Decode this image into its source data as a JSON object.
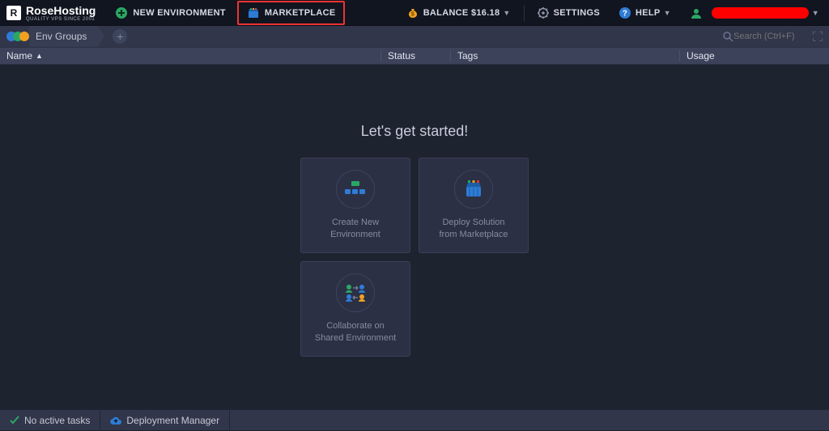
{
  "brand": {
    "name": "RoseHosting",
    "tagline": "QUALITY VPS SINCE 2001"
  },
  "topbar": {
    "new_env": "NEW ENVIRONMENT",
    "marketplace": "MARKETPLACE",
    "balance_label": "BALANCE",
    "balance_amount": "$16.18",
    "settings": "SETTINGS",
    "help": "HELP"
  },
  "subheader": {
    "env_groups": "Env Groups",
    "search_placeholder": "Search (Ctrl+F)"
  },
  "table": {
    "name": "Name",
    "status": "Status",
    "tags": "Tags",
    "usage": "Usage"
  },
  "main": {
    "heading": "Let's get started!",
    "cards": {
      "create": {
        "line1": "Create New",
        "line2": "Environment"
      },
      "deploy": {
        "line1": "Deploy Solution",
        "line2": "from Marketplace"
      },
      "collab": {
        "line1": "Collaborate on",
        "line2": "Shared Environment"
      }
    }
  },
  "bottombar": {
    "no_tasks": "No active tasks",
    "deploy_mgr": "Deployment Manager"
  },
  "colors": {
    "accent_green": "#2aa765",
    "accent_blue": "#2e7cd6",
    "accent_orange": "#f0a11f",
    "highlight_red": "#e33333"
  }
}
